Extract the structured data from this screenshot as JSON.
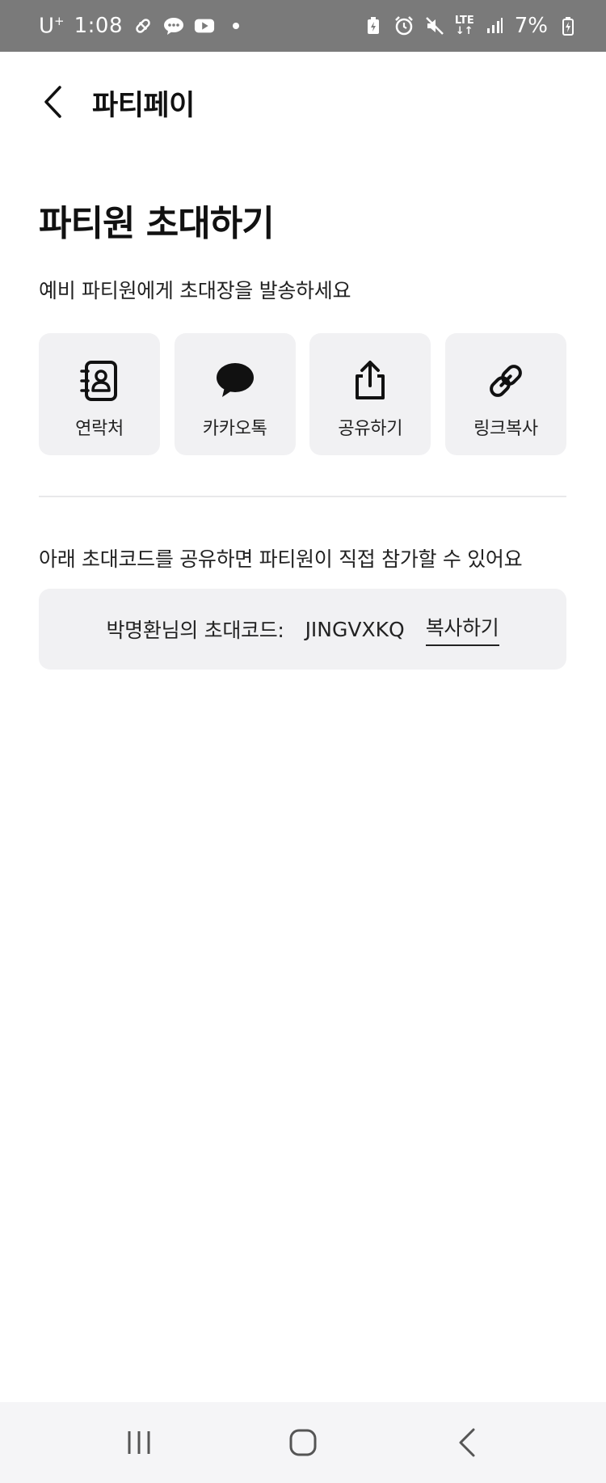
{
  "status_bar": {
    "carrier": "U",
    "carrier_sup": "+",
    "time": "1:08",
    "lte": "LTE",
    "battery": "7%"
  },
  "header": {
    "title": "파티페이"
  },
  "main": {
    "title": "파티원 초대하기",
    "subtitle": "예비 파티원에게 초대장을 발송하세요",
    "share_options": [
      {
        "label": "연락처",
        "icon": "contacts-icon"
      },
      {
        "label": "카카오톡",
        "icon": "kakaotalk-icon"
      },
      {
        "label": "공유하기",
        "icon": "share-icon"
      },
      {
        "label": "링크복사",
        "icon": "link-icon"
      }
    ],
    "code_description": "아래 초대코드를 공유하면 파티원이 직접 참가할 수 있어요",
    "code_label": "박명환님의 초대코드:",
    "code_value": "JINGVXKQ",
    "copy_label": "복사하기"
  },
  "colors": {
    "status_bar_bg": "#7a7a7a",
    "card_bg": "#f1f1f3",
    "text": "#111111"
  }
}
